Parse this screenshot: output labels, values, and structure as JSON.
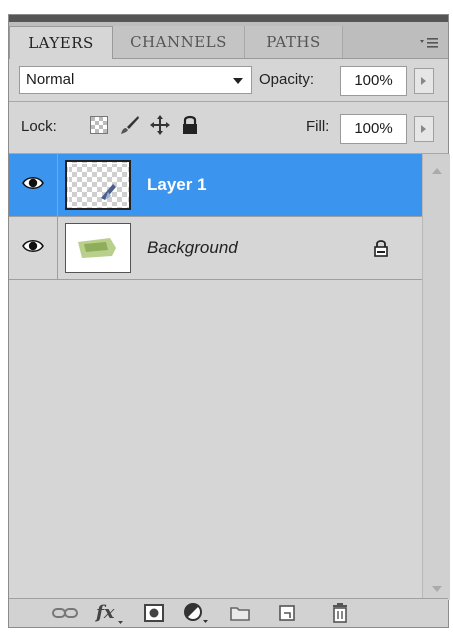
{
  "tabs": [
    {
      "label": "LAYERS",
      "active": true
    },
    {
      "label": "CHANNELS",
      "active": false
    },
    {
      "label": "PATHS",
      "active": false
    }
  ],
  "options": {
    "blend_mode": "Normal",
    "opacity_label": "Opacity:",
    "opacity_value": "100%",
    "lock_label": "Lock:",
    "fill_label": "Fill:",
    "fill_value": "100%"
  },
  "layers": [
    {
      "name": "Layer 1",
      "selected": true,
      "visible": true,
      "locked": false
    },
    {
      "name": "Background",
      "selected": false,
      "visible": true,
      "locked": true
    }
  ],
  "footer_icons": [
    "link-layers-icon",
    "fx-icon",
    "layer-mask-icon",
    "adjustment-layer-icon",
    "new-group-icon",
    "new-layer-icon",
    "trash-icon"
  ],
  "colors": {
    "selection": "#3b95ee",
    "panel": "#d6d6d6"
  }
}
